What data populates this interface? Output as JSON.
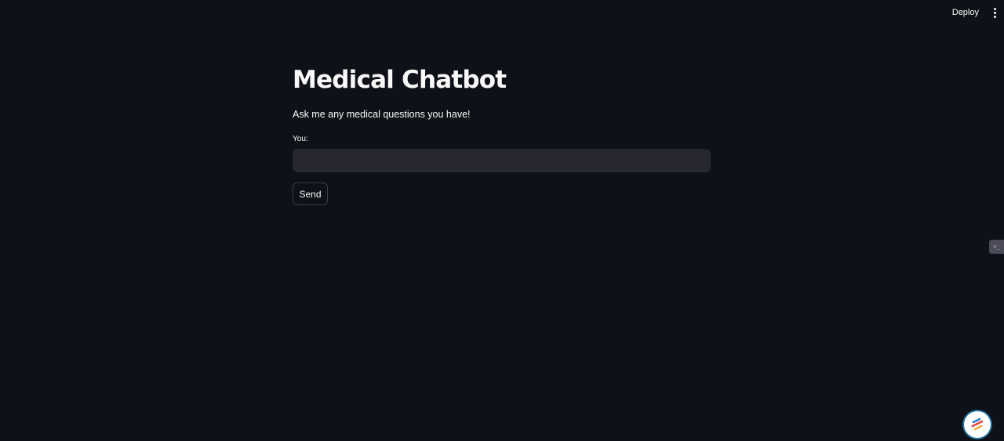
{
  "toolbar": {
    "deploy_label": "Deploy",
    "menu_icon": "more-vertical-icon"
  },
  "main": {
    "title": "Medical Chatbot",
    "subtitle": "Ask me any medical questions you have!",
    "input_label": "You:",
    "input_value": "",
    "input_placeholder": "",
    "send_label": "Send"
  },
  "widgets": {
    "side_widget_icon": "terminal-icon",
    "floating_logo_icon": "app-logo-icon"
  },
  "colors": {
    "background": "#0e1117",
    "input_background": "#262730",
    "text": "#fafafa",
    "button_border": "#3b3d45"
  }
}
